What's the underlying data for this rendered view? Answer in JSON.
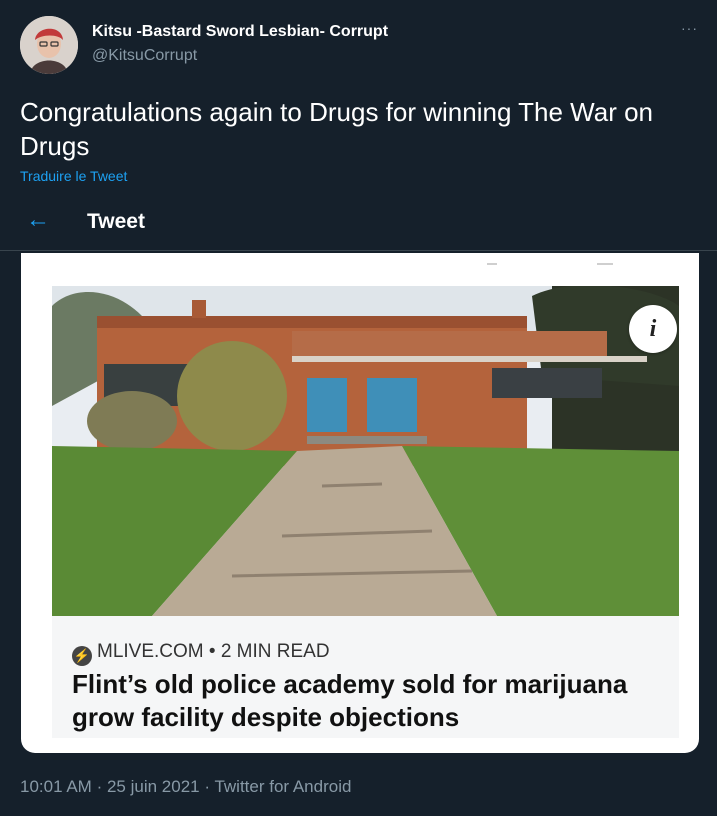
{
  "author": {
    "name": "Kitsu -Bastard Sword Lesbian- Corrupt",
    "handle": "@KitsuCorrupt"
  },
  "more_menu_label": "···",
  "tweet": {
    "text": "Congratulations again to Drugs for winning The War on Drugs",
    "translate_label": "Traduire le Tweet"
  },
  "top_bar": {
    "back_glyph": "←",
    "title": "Tweet"
  },
  "embedded_card": {
    "info_glyph": "i",
    "source": "MLIVE.COM • 2 MIN READ",
    "headline": "Flint’s old police academy sold for marijuana grow facility despite objections"
  },
  "footer": {
    "time": "10:01 AM",
    "separator": "·",
    "date": "25 juin 2021",
    "client": "Twitter for Android"
  },
  "colors": {
    "background": "#15202b",
    "accent": "#1da1f2",
    "secondary_text": "#8899a6"
  }
}
